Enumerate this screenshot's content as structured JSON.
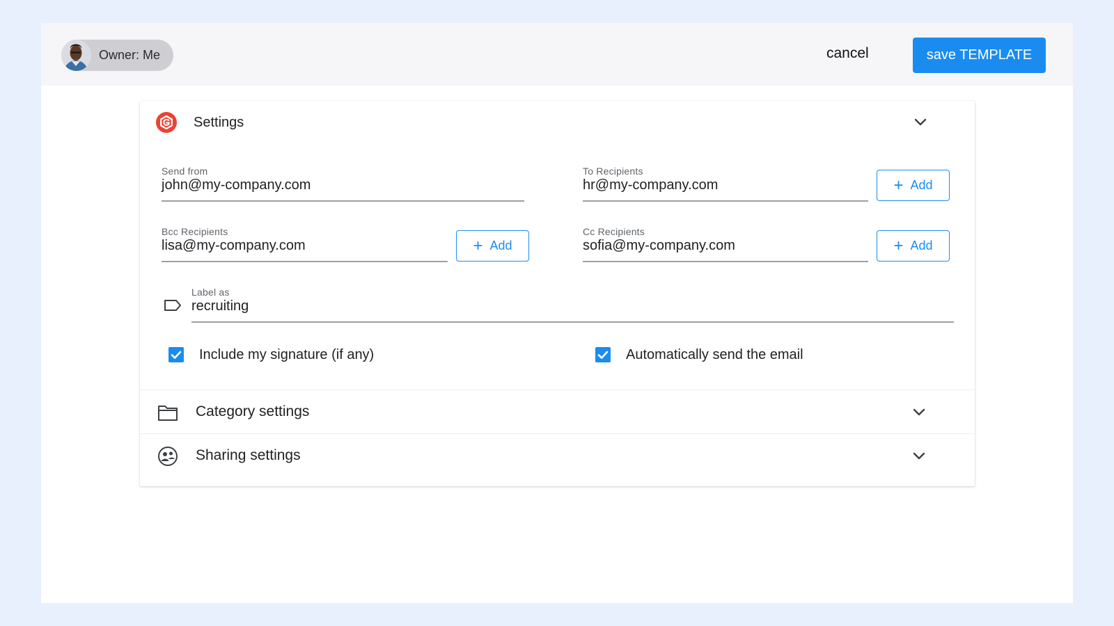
{
  "header": {
    "owner_label": "Owner: Me",
    "cancel_label": "cancel",
    "save_label": "save TEMPLATE"
  },
  "settings": {
    "title": "Settings",
    "send_from": {
      "label": "Send from",
      "value": "john@my-company.com"
    },
    "to_recipients": {
      "label": "To Recipients",
      "value": "hr@my-company.com",
      "add_label": "Add"
    },
    "bcc_recipients": {
      "label": "Bcc Recipients",
      "value": "lisa@my-company.com",
      "add_label": "Add"
    },
    "cc_recipients": {
      "label": "Cc Recipients",
      "value": "sofia@my-company.com",
      "add_label": "Add"
    },
    "label_as": {
      "label": "Label as",
      "value": "recruiting",
      "icon": "label-icon"
    },
    "include_signature": {
      "label": "Include my signature (if any)",
      "checked": true
    },
    "auto_send": {
      "label": "Automatically send the email",
      "checked": true
    }
  },
  "sections": [
    {
      "title": "Category settings",
      "icon": "folder-icon"
    },
    {
      "title": "Sharing settings",
      "icon": "sharing-icon"
    }
  ],
  "colors": {
    "accent": "#1a8cf0",
    "logo": "#ea4335",
    "background": "#e8f0fd"
  }
}
